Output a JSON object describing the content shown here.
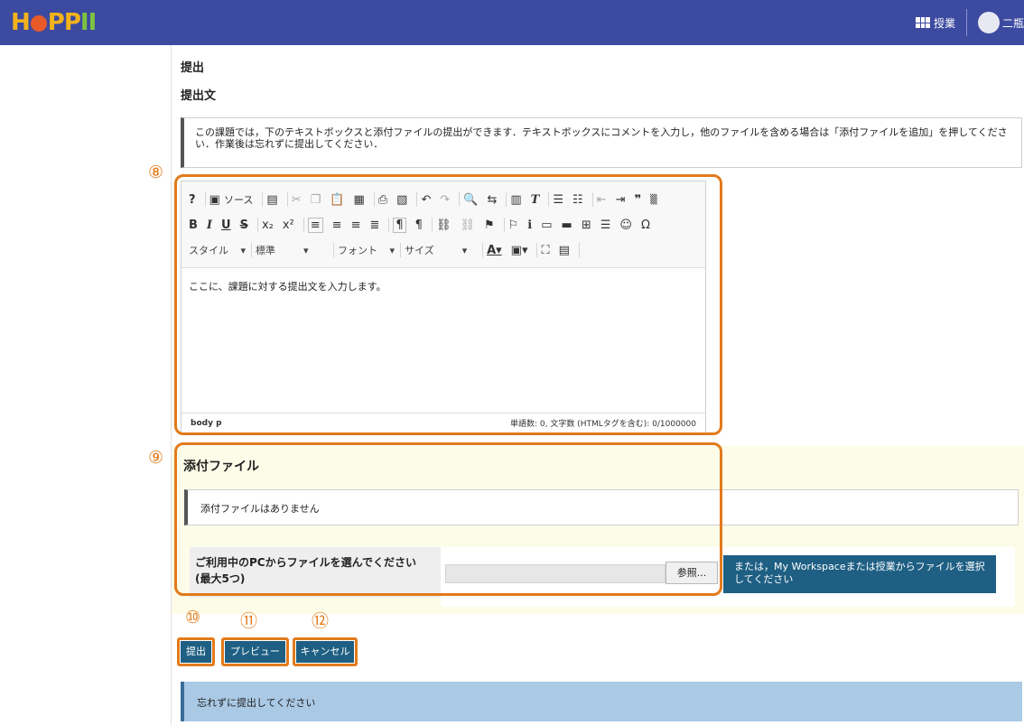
{
  "header": {
    "logo": "HoPPII",
    "course_link": "授業",
    "user_name": "二瓶"
  },
  "page": {
    "title": "提出",
    "subtitle": "提出文",
    "instructions": "この課題では，下のテキストボックスと添付ファイルの提出ができます．テキストボックスにコメントを入力し，他のファイルを含める場合は「添付ファイルを追加」を押してください．作業後は忘れずに提出してください．"
  },
  "callouts": [
    "⑧",
    "⑨",
    "⑩",
    "⑪",
    "⑫"
  ],
  "editor": {
    "source_label": "ソース",
    "style_dropdown": "スタイル",
    "format_dropdown": "標準",
    "font_dropdown": "フォント",
    "size_dropdown": "サイズ",
    "content": "ここに、課題に対する提出文を入力します。",
    "path": "body  p",
    "word_count": "単語数: 0, 文字数 (HTMLタグを含む): 0/1000000"
  },
  "attachments": {
    "title": "添付ファイル",
    "empty_message": "添付ファイルはありません",
    "upload_label": "ご利用中のPCからファイルを選んでください (最大5つ)",
    "browse_label": "参照...",
    "workspace_label": "または，My Workspaceまたは授業からファイルを選択してください"
  },
  "actions": {
    "submit": "提出",
    "preview": "プレビュー",
    "cancel": "キャンセル"
  },
  "notice": "忘れずに提出してください",
  "colors": {
    "topbar": "#3c4aa0",
    "button": "#1e5f83",
    "highlight": "#e27a1a",
    "notice_bg": "#a9c9e5"
  }
}
